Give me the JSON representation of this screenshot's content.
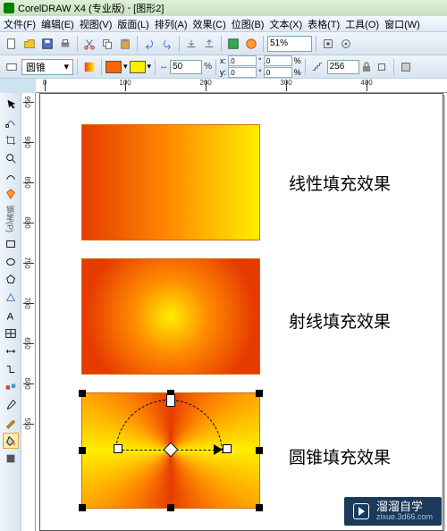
{
  "titlebar": {
    "app": "CorelDRAW X4 (专业版)",
    "doc": "[图形2]"
  },
  "menubar": {
    "file": "文件(F)",
    "edit": "编辑(E)",
    "view": "视图(V)",
    "layout": "版面(L)",
    "arrange": "排列(A)",
    "effects": "效果(C)",
    "bitmap": "位图(B)",
    "text": "文本(X)",
    "table": "表格(T)",
    "tools": "工具(O)",
    "window": "窗口(W)"
  },
  "toolbar": {
    "zoom": "51%",
    "nudge": "50",
    "copies": "256",
    "x": ".0",
    "y": ".0",
    "pct1": ".0",
    "pct2": ".0"
  },
  "property": {
    "fill_type": "圆锥",
    "color1": "#ff6600",
    "color2": "#ffee00",
    "pen_label": "钢笔(P)"
  },
  "ruler_top": [
    "0",
    "100",
    "200",
    "300",
    "400"
  ],
  "ruler_left": [
    "950",
    "900",
    "850",
    "800",
    "750",
    "700",
    "650",
    "600",
    "550"
  ],
  "canvas": {
    "label1": "线性填充效果",
    "label2": "射线填充效果",
    "label3": "圆锥填充效果"
  },
  "watermark": {
    "brand": "溜溜自学",
    "url": "zixue.3d66.com"
  }
}
